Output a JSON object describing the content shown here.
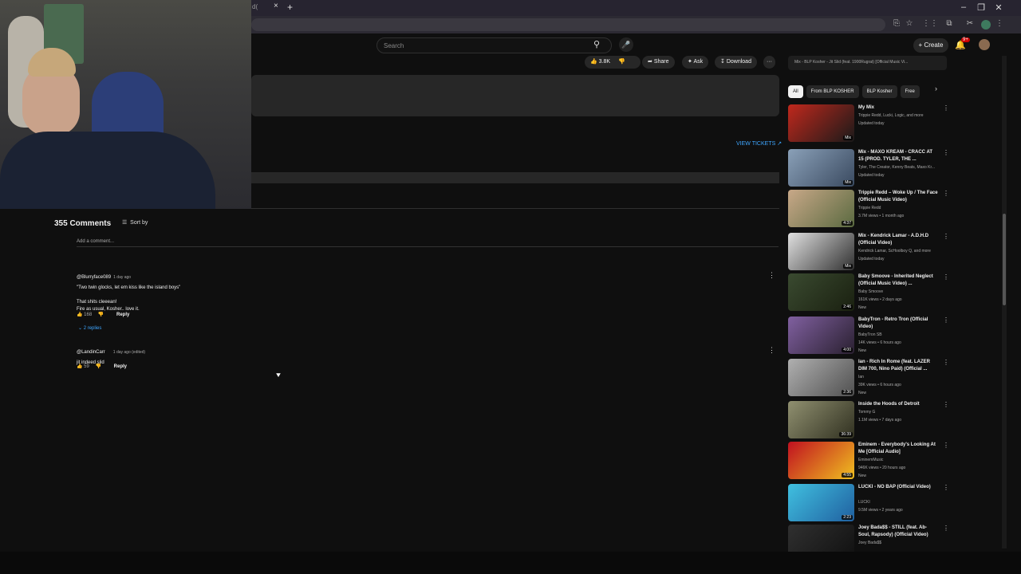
{
  "browser": {
    "tab_title": "d(",
    "tab_close": "×",
    "new_tab": "+",
    "window_controls": [
      "–",
      "❐",
      "✕"
    ],
    "toolbar_icons": [
      "⎘",
      "☆",
      "⋮⋮",
      "⧉",
      "✂",
      "⋮"
    ]
  },
  "header": {
    "search_placeholder": "Search",
    "create_label": "Create",
    "notifications_badge": "9+"
  },
  "video_actions": {
    "likes": "3.8K",
    "share": "Share",
    "ask": "Ask",
    "download": "Download",
    "more": "···"
  },
  "view_tickets": "VIEW TICKETS",
  "comments": {
    "count_label": "355 Comments",
    "sort_label": "Sort by",
    "add_placeholder": "Add a comment...",
    "items": [
      {
        "author": "@Blurryface089",
        "time": "1 day ago",
        "lines": [
          "\"Two twin glocks, let em kiss like the island boys\"",
          "",
          "That shits cleeean!",
          "Fire as usual, Kosher.. love it."
        ],
        "likes": "168",
        "reply": "Reply",
        "replies": "2 replies"
      },
      {
        "author": "@LandinCarr",
        "time": "1 day ago (edited)",
        "lines": [
          "jit indeed slid"
        ],
        "likes": "59",
        "reply": "Reply"
      }
    ]
  },
  "sidebar": {
    "mix_bar_text": "Mix - BLP Kosher - Jit Slid (feat. 1900Rugrat) [Official Music Vi...",
    "chips": [
      "All",
      "From BLP KOSHER",
      "BLP Kosher",
      "Free"
    ],
    "recommendations": [
      {
        "title": "My Mix",
        "channel": "Trippie Redd, Lucki, Logic, and more",
        "meta": "Updated today",
        "badge": "Mix",
        "colors": [
          "#c0281c",
          "#1a1a1a"
        ]
      },
      {
        "title": "Mix - MAXO KREAM - CRACC AT 15 (PROD. TYLER, THE ...",
        "channel": "Tyler, The Creator, Kenny Beats, Maxo Kr...",
        "meta": "Updated today",
        "badge": "Mix",
        "colors": [
          "#8aa0b8",
          "#3a4a60"
        ]
      },
      {
        "title": "Trippie Redd – Woke Up / The Face (Official Music Video)",
        "channel": "Trippie Redd",
        "meta": "3.7M views • 1 month ago",
        "badge": "4:37",
        "colors": [
          "#c8a888",
          "#5a6a40"
        ]
      },
      {
        "title": "Mix - Kendrick Lamar - A.D.H.D (Official Video)",
        "channel": "Kendrick Lamar, ScHoolboy Q, and more",
        "meta": "Updated today",
        "badge": "Mix",
        "colors": [
          "#e0e0e0",
          "#303030"
        ]
      },
      {
        "title": "Baby Smoove - Inherited Neglect (Official Music Video) ...",
        "channel": "Baby Smoove",
        "meta": "161K views • 2 days ago",
        "extra": "New",
        "badge": "2:46",
        "colors": [
          "#3a4a30",
          "#1a2010"
        ]
      },
      {
        "title": "BabyTron - Retro Tron (Official Video)",
        "channel": "BabyTron SB",
        "meta": "14K views • 6 hours ago",
        "extra": "New",
        "badge": "4:00",
        "colors": [
          "#8060a0",
          "#2a2030"
        ]
      },
      {
        "title": "Ian - Rich In Rome (feat. LAZER DIM 700, Nino Paid) (Official ...",
        "channel": "Ian",
        "meta": "39K views • 6 hours ago",
        "extra": "New",
        "badge": "2:36",
        "colors": [
          "#b0b0b0",
          "#505050"
        ]
      },
      {
        "title": "Inside the Hoods of Detroit",
        "channel": "Tommy G",
        "meta": "1.1M views • 7 days ago",
        "badge": "36:39",
        "colors": [
          "#909070",
          "#303020"
        ]
      },
      {
        "title": "Eminem - Everybody's Looking At Me [Official Audio]",
        "channel": "EminemMusic",
        "meta": "946K views • 20 hours ago",
        "extra": "New",
        "badge": "4:55",
        "colors": [
          "#c01020",
          "#f0c020"
        ]
      },
      {
        "title": "LUCKI - NO BAP (Official Video)",
        "channel": "LUCKI",
        "meta": "9.5M views • 2 years ago",
        "badge": "2:23",
        "colors": [
          "#40c0e0",
          "#2060a0"
        ]
      },
      {
        "title": "Joey Bada$$ - STILL (feat. Ab-Soul, Rapsody) (Official Video)",
        "channel": "Joey Bada$$",
        "meta": "",
        "badge": "",
        "colors": [
          "#303030",
          "#101010"
        ]
      }
    ]
  }
}
